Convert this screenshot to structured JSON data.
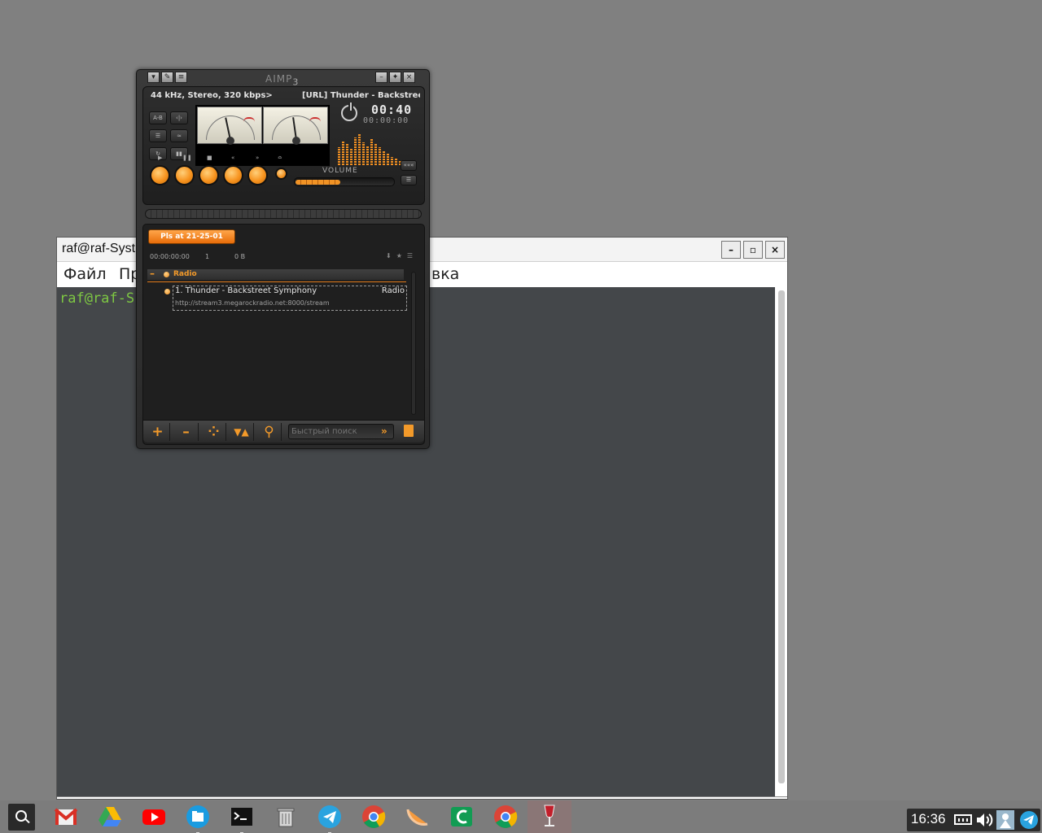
{
  "terminal": {
    "title": "raf@raf-Syst",
    "menu": [
      "Файл",
      "Пр",
      "вка"
    ],
    "prompt": "raf@raf-S",
    "buttons": {
      "minimize": "–",
      "maximize": "▫",
      "close": "×"
    }
  },
  "aimp": {
    "logo": "AIMP",
    "logo_version": "3",
    "stream_info": "44 kHz, Stereo, 320 kbps>",
    "now_playing": "[URL] Thunder - Backstreet",
    "time_elapsed": "00:40",
    "time_total": "00:00:00",
    "volume_label": "VOLUME",
    "volume_level_percent": 45,
    "side_buttons": [
      "A-B",
      "‹|›",
      "☰",
      "≈",
      "↻",
      "▮▮"
    ],
    "transport_symbols": [
      "▶",
      "❚❚",
      "■",
      "«",
      "»",
      "≏"
    ],
    "playlist": {
      "tab_label": "Pls at 21-25-01",
      "stats": {
        "duration": "00:00:00:00",
        "count": "1",
        "size": "0 B"
      },
      "group_name": "Radio",
      "tracks": [
        {
          "title": "1. Thunder - Backstreet Symphony",
          "category": "Radio",
          "url": "http://stream3.megarockradio.net:8000/stream"
        }
      ],
      "search_placeholder": "Быстрый поиск",
      "toolbar": {
        "add": "+",
        "remove": "–",
        "misc": "⁘",
        "sort": "▼▲",
        "find": "⚲",
        "go": "»"
      }
    },
    "accent_color": "#f39a2a"
  },
  "taskbar": {
    "clock": "16:36",
    "apps": [
      "gmail-icon",
      "google-drive-icon",
      "youtube-icon",
      "files-icon",
      "terminal-icon",
      "trash-icon",
      "telegram-icon",
      "chrome-icon",
      "melon-icon",
      "app-c-icon",
      "chrome-alt-icon",
      "wine-icon"
    ],
    "tray_icons": [
      "network-icon",
      "volume-icon",
      "user-icon",
      "telegram-tray-icon"
    ]
  }
}
